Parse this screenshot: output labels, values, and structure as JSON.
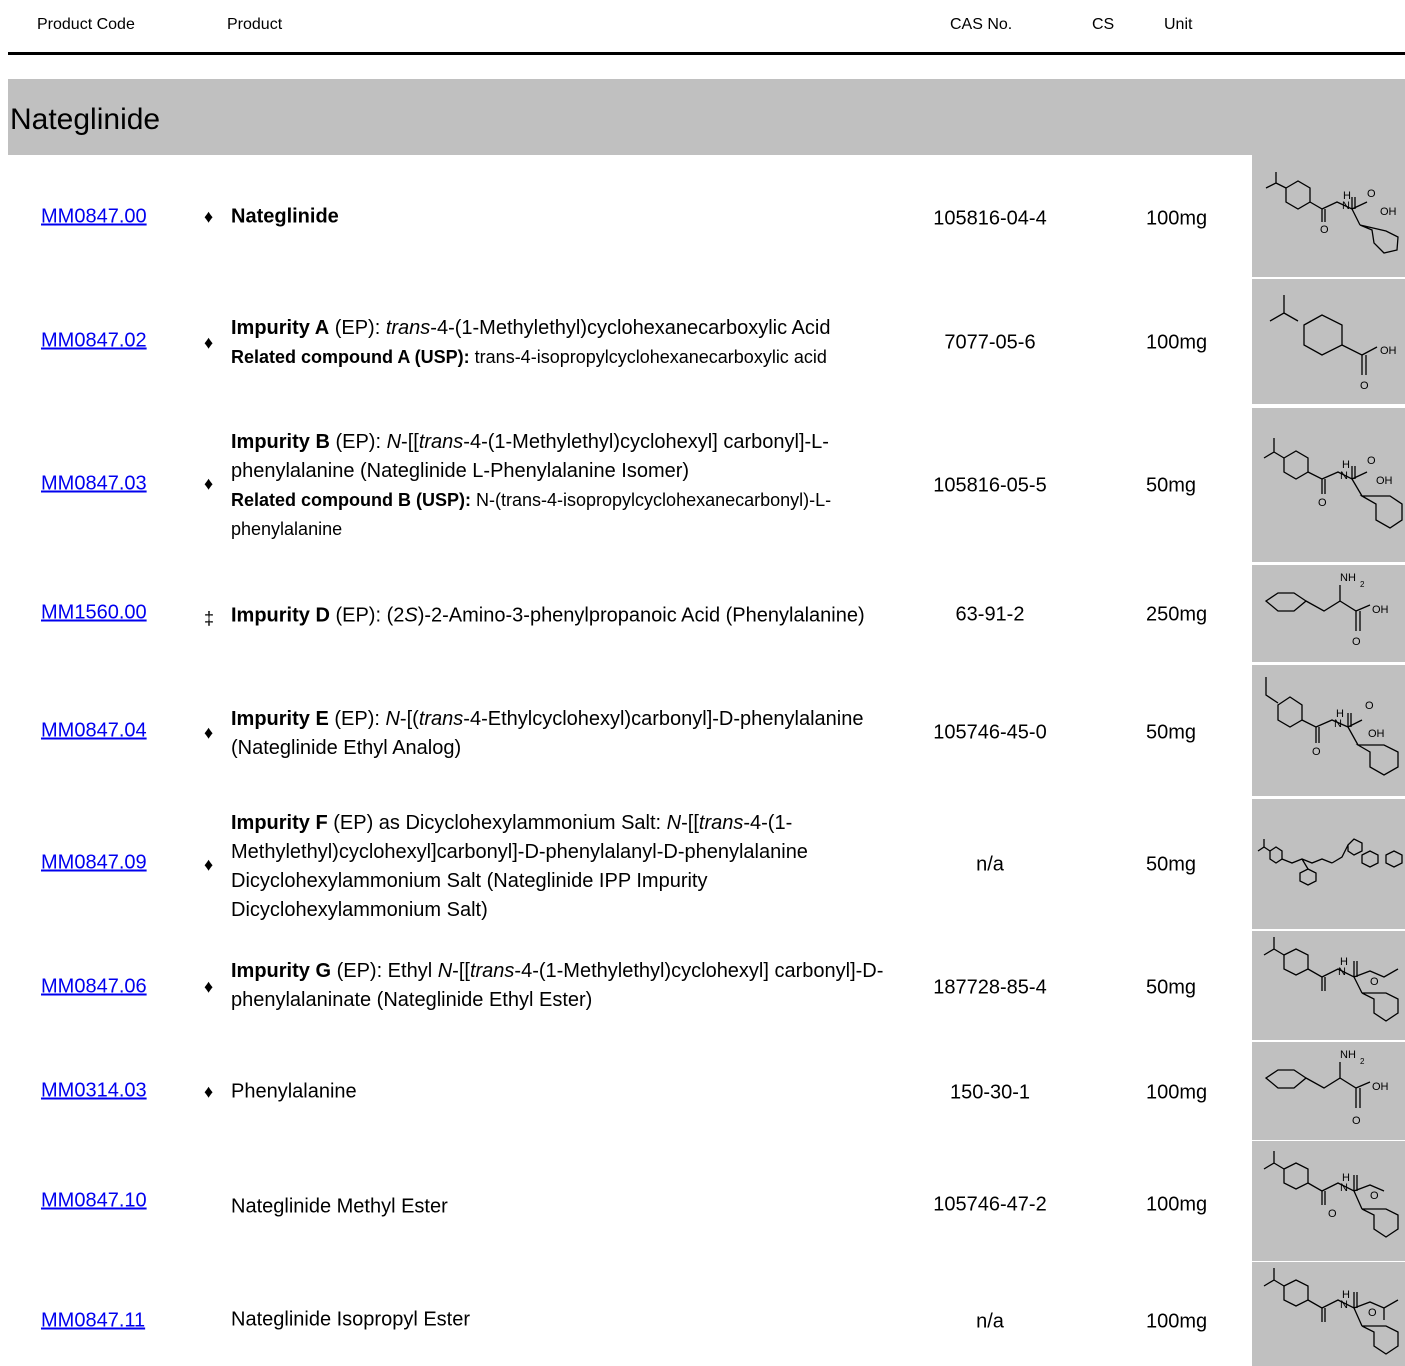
{
  "header": {
    "col_code": "Product Code",
    "col_product": "Product",
    "col_cas": "CAS No.",
    "col_cs": "CS",
    "col_unit": "Unit"
  },
  "section_title": "Nateglinide",
  "rows": [
    {
      "code": "MM0847.00",
      "mark": "♦",
      "cas": "105816-04-4",
      "unit": "100mg",
      "p": {
        "t1": "Nateglinide"
      }
    },
    {
      "code": "MM0847.02",
      "mark": "♦",
      "cas": "7077-05-6",
      "unit": "100mg",
      "p": {
        "b1": "Impurity A",
        "t1": " (EP): ",
        "i1": "trans",
        "t2": "-4-(1-Methylethyl)cyclohexanecarboxylic Acid",
        "b2": "Related compound A (USP):",
        "t3": " trans-4-isopropylcyclohexanecarboxylic acid"
      }
    },
    {
      "code": "MM0847.03",
      "mark": "♦",
      "cas": "105816-05-5",
      "unit": "50mg",
      "p": {
        "b1": "Impurity B",
        "t1": " (EP): ",
        "i1": "N",
        "t2": "-[[",
        "i2": "trans",
        "t3": "-4-(1-Methylethyl)cyclohexyl] carbonyl]-L-phenylalanine (Nateglinide L-Phenylalanine Isomer)",
        "b2": "Related compound B (USP):",
        "t4": " N-(trans-4-isopropylcyclohexanecarbonyl)-L-phenylalanine"
      }
    },
    {
      "code": "MM1560.00",
      "mark": "‡",
      "cas": "63-91-2",
      "unit": "250mg",
      "p": {
        "b1": "Impurity D",
        "t1": " (EP): (2",
        "i1": "S",
        "t2": ")-2-Amino-3-phenylpropanoic Acid (Phenylalanine)"
      }
    },
    {
      "code": "MM0847.04",
      "mark": "♦",
      "cas": "105746-45-0",
      "unit": "50mg",
      "p": {
        "b1": "Impurity E",
        "t1": " (EP): ",
        "i1": "N",
        "t2": "-[(",
        "i2": "trans",
        "t3": "-4-Ethylcyclohexyl)carbonyl]-D-phenylalanine (Nateglinide Ethyl Analog)"
      }
    },
    {
      "code": "MM0847.09",
      "mark": "♦",
      "cas": "n/a",
      "unit": "50mg",
      "p": {
        "b1": "Impurity F",
        "t1": " (EP) as Dicyclohexylammonium Salt: ",
        "i1": "N",
        "t2": "-[[",
        "i2": "trans",
        "t3": "-4-(1-Methylethyl)cyclohexyl]carbonyl]-D-phenylalanyl-D-phenylalanine Dicyclohexylammonium Salt (Nateglinide IPP Impurity Dicyclohexylammonium Salt)"
      }
    },
    {
      "code": "MM0847.06",
      "mark": "♦",
      "cas": "187728-85-4",
      "unit": "50mg",
      "p": {
        "b1": "Impurity G",
        "t1": " (EP): Ethyl ",
        "i1": "N",
        "t2": "-[[",
        "i2": "trans",
        "t3": "-4-(1-Methylethyl)cyclohexyl] carbonyl]-D-phenylalaninate (Nateglinide Ethyl Ester)"
      }
    },
    {
      "code": "MM0314.03",
      "mark": "♦",
      "cas": "150-30-1",
      "unit": "100mg",
      "p": {
        "t1": "Phenylalanine"
      }
    },
    {
      "code": "MM0847.10",
      "mark": "",
      "cas": "105746-47-2",
      "unit": "100mg",
      "p": {
        "t1": "Nateglinide Methyl Ester"
      }
    },
    {
      "code": "MM0847.11",
      "mark": "",
      "cas": "n/a",
      "unit": "100mg",
      "p": {
        "t1": "Nateglinide Isopropyl Ester"
      }
    }
  ],
  "structure_labels": {
    "h": "H",
    "n": "N",
    "o": "O",
    "oh": "OH",
    "nh2": "NH",
    "nh2_sub": "2"
  }
}
